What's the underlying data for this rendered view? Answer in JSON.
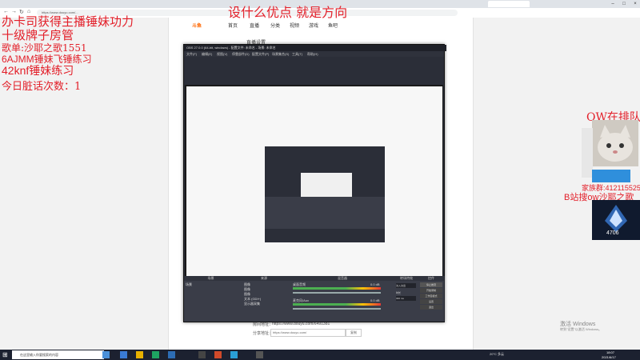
{
  "browser": {
    "tabs": [
      "...",
      "...",
      "...",
      "...",
      "...",
      "...",
      "...",
      "...",
      "...",
      "...",
      "...",
      "...",
      "...",
      "...",
      "...",
      "...",
      "...",
      "..."
    ],
    "active_tab": "...",
    "url": "https://www.douyu.com/..."
  },
  "site": {
    "logo": "斗鱼",
    "nav": [
      "首页",
      "直播",
      "分类",
      "视频",
      "游戏",
      "鱼吧"
    ],
    "section_label": "直播设置",
    "room_link_label": "房间地址：",
    "room_link": "https://www.douyu.com/6491381",
    "pull_label": "分享地址：",
    "pull_value": "https://www.douyu.com/",
    "copy_button": "复制"
  },
  "overlay": {
    "top_banner": "设什么优点 就是方向",
    "line1": "办卡司获得主播锤妹功力",
    "line2": "十级牌子房管",
    "line3": "歌单:沙耶之歌1551",
    "line4": "6AJMM锤妹飞锤练习",
    "line5": "42knf锤妹练习",
    "line6": "今日脏话次数：1",
    "ow_queue": "OW在排队",
    "fan_group": "家族群:412115525",
    "bilibili": "B站搜ow沙耶之歌",
    "rank_number": "4706"
  },
  "obs": {
    "title": "OBS 27.0.0 (64-bit, windows) - 配置文件: 未命名 - 场景: 未命名",
    "menu": [
      "文件(F)",
      "编辑(E)",
      "视图(V)",
      "停靠部件(D)",
      "配置文件(P)",
      "场景集合(S)",
      "工具(T)",
      "帮助(H)"
    ],
    "docks": {
      "scenes": "场景",
      "sources": "来源",
      "mixer": "混音器",
      "transitions": "转场特效",
      "controls": "控件"
    },
    "scene_item": "场景",
    "sources": [
      "图像",
      "图像",
      "图像",
      "文本 (GDI+)",
      "显示器采集"
    ],
    "mixer_tracks": [
      "桌面音频",
      "麦克风/Aux"
    ],
    "mixer_values": [
      "0.0 dB",
      "0.0 dB"
    ],
    "transition_value": "淡入淡出",
    "duration_label": "时长",
    "duration_value": "300 ms",
    "controls": [
      "停止推流",
      "开始录制",
      "工作室模式",
      "设置",
      "退出"
    ]
  },
  "watermark": {
    "line1": "激活 Windows",
    "line2": "转到\"设置\"以激活 Windows。"
  },
  "taskbar": {
    "search_placeholder": "在这里输入你要搜索的内容",
    "weather": "20°C 多云",
    "time": "18:07",
    "date": "2021/6/17"
  }
}
